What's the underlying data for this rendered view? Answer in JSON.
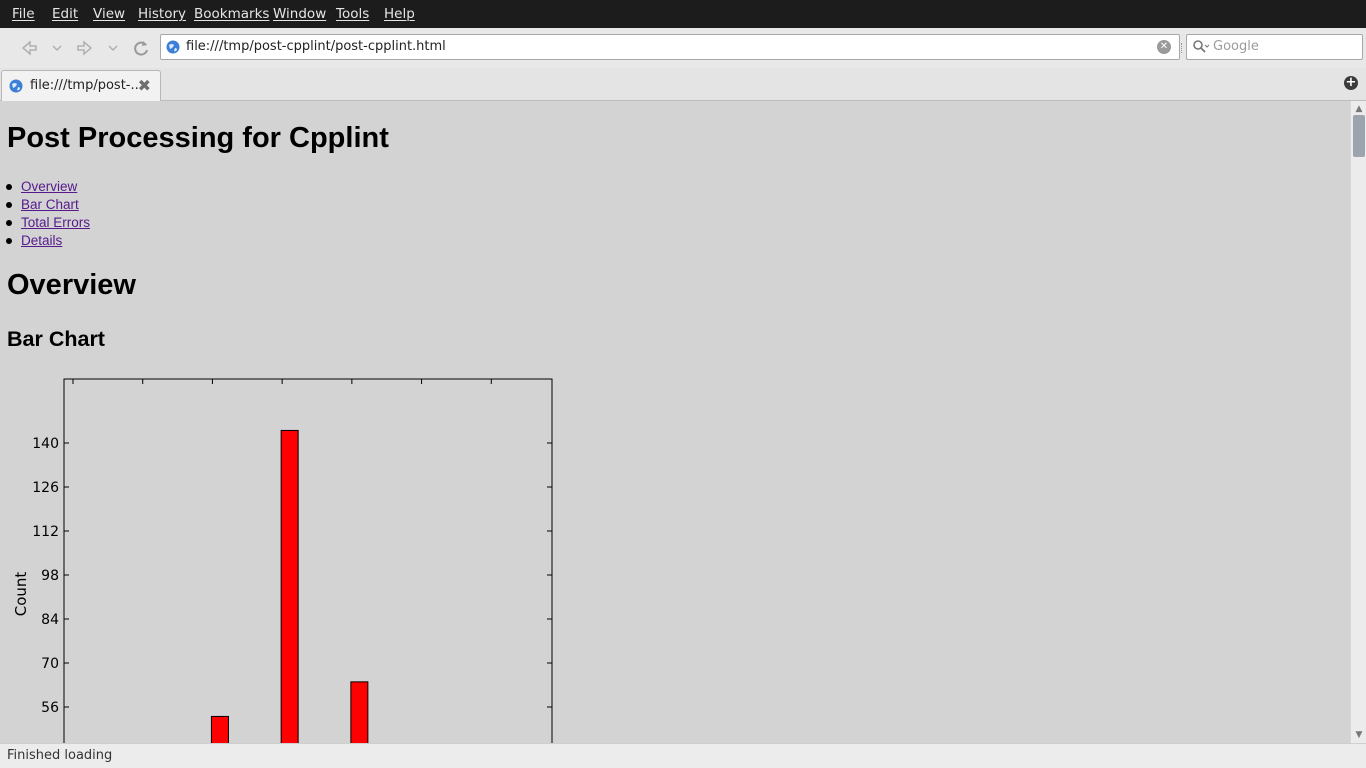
{
  "menubar": {
    "items": [
      "File",
      "Edit",
      "View",
      "History",
      "Bookmarks",
      "Window",
      "Tools",
      "Help"
    ]
  },
  "navbar": {
    "url": "file:///tmp/post-cpplint/post-cpplint.html",
    "search_placeholder": "Google",
    "icons": [
      "back-icon",
      "forward-icon",
      "reload-icon",
      "globe-icon",
      "clear-url-icon",
      "search-icon"
    ]
  },
  "tabs": [
    {
      "title": "file:///tmp/post-...",
      "active": true
    }
  ],
  "page": {
    "title": "Post Processing for Cpplint",
    "toc": [
      "Overview",
      "Bar Chart",
      "Total Errors",
      "Details"
    ],
    "overview_heading": "Overview",
    "bar_chart_heading": "Bar Chart",
    "link_color": "#551a8b",
    "background_color": "#d3d3d3"
  },
  "chart_data": {
    "type": "bar",
    "ylabel": "Count",
    "xlabel": "",
    "title": "",
    "yticks": [
      56,
      70,
      84,
      98,
      112,
      126,
      140
    ],
    "ylim": [
      42,
      160
    ],
    "bar_color": "#ff0000",
    "values": [
      {
        "x": 2,
        "y": 53
      },
      {
        "x": 3,
        "y": 144
      },
      {
        "x": 4,
        "y": 64
      }
    ],
    "x_categories_count": 7,
    "visible_portion": "top part only; bottom axis cut off by viewport"
  },
  "statusbar": {
    "text": "Finished loading"
  }
}
